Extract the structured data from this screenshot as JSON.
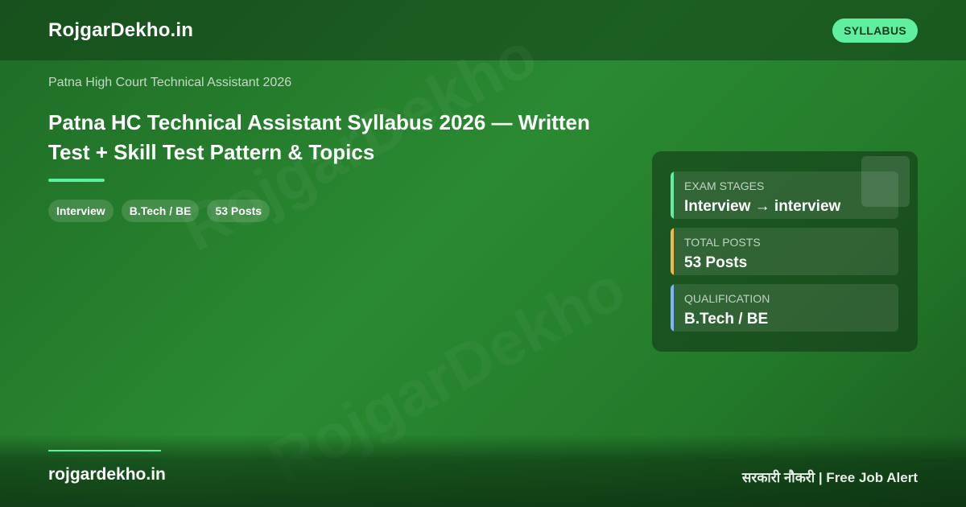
{
  "header": {
    "brand": "RojgarDekho.in",
    "badge": "SYLLABUS"
  },
  "watermark": "RojgarDekho",
  "main": {
    "subtitle": "Patna High Court Technical Assistant 2026",
    "title": "Patna HC Technical Assistant Syllabus 2026 — Written Test + Skill Test Pattern & Topics",
    "tags": [
      "Interview",
      "B.Tech / BE",
      "53 Posts"
    ]
  },
  "info_card": {
    "rows": [
      {
        "label": "EXAM STAGES",
        "value": "Interview → interview",
        "accent": "#5ef0a0"
      },
      {
        "label": "TOTAL POSTS",
        "value": "53 Posts",
        "accent": "#f0b84a"
      },
      {
        "label": "QUALIFICATION",
        "value": "B.Tech / BE",
        "accent": "#7fb2ff"
      }
    ]
  },
  "footer": {
    "site": "rojgardekho.in",
    "tagline": "सरकारी नौकरी | Free Job Alert"
  },
  "colors": {
    "accent": "#5ef0a0",
    "background": "#2a8a31"
  }
}
